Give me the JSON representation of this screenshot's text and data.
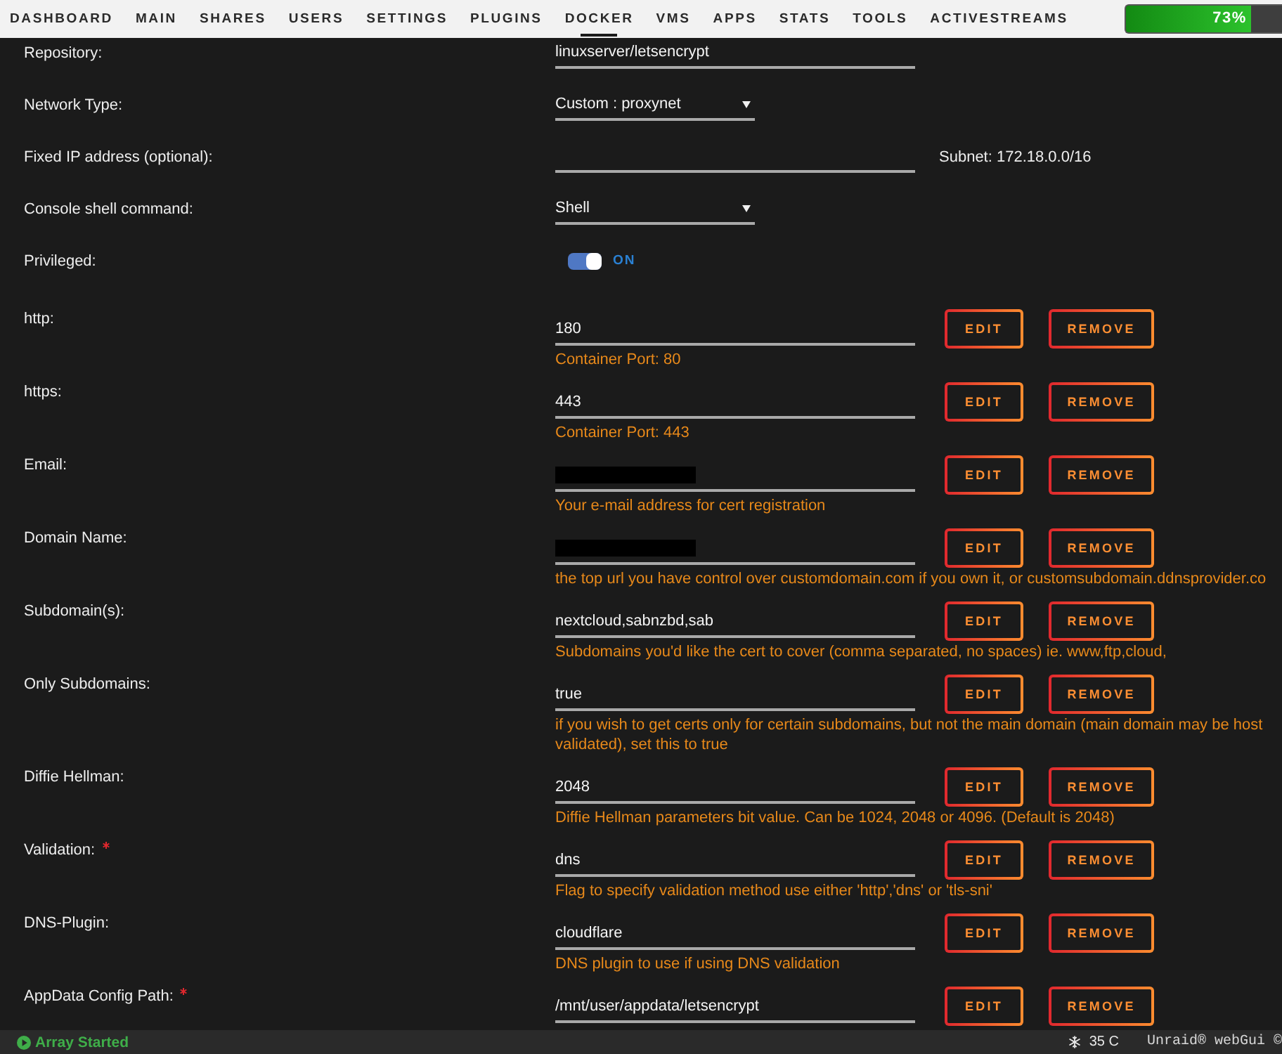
{
  "nav": {
    "items": [
      {
        "label": "DASHBOARD",
        "selected": false
      },
      {
        "label": "MAIN",
        "selected": false
      },
      {
        "label": "SHARES",
        "selected": false
      },
      {
        "label": "USERS",
        "selected": false
      },
      {
        "label": "SETTINGS",
        "selected": false
      },
      {
        "label": "PLUGINS",
        "selected": false
      },
      {
        "label": "DOCKER",
        "selected": true
      },
      {
        "label": "VMS",
        "selected": false
      },
      {
        "label": "APPS",
        "selected": false
      },
      {
        "label": "STATS",
        "selected": false
      },
      {
        "label": "TOOLS",
        "selected": false
      },
      {
        "label": "ACTIVESTREAMS",
        "selected": false
      }
    ],
    "cpu_meter": {
      "level": 0.8,
      "reading": "73%"
    }
  },
  "settings": [
    {
      "kind": "text",
      "label": "Repository:",
      "value": "linuxserver/letsencrypt"
    },
    {
      "kind": "select",
      "label": "Network Type:",
      "value": "Custom : proxynet"
    },
    {
      "kind": "text",
      "label": "Fixed IP address (optional):",
      "note": "Subnet: 172.18.0.0/16"
    },
    {
      "kind": "select",
      "label": "Console shell command:",
      "value": "Shell"
    },
    {
      "kind": "toggle",
      "label": "Privileged:",
      "on": true,
      "state_label": "ON"
    }
  ],
  "variables": [
    {
      "label": "http:",
      "required": false,
      "redacted": false,
      "value": "180",
      "buttons": [
        "EDIT",
        "REMOVE"
      ],
      "hint": "Container Port: 80"
    },
    {
      "label": "https:",
      "required": false,
      "redacted": false,
      "value": "443",
      "buttons": [
        "EDIT",
        "REMOVE"
      ],
      "hint": "Container Port: 443"
    },
    {
      "label": "Email:",
      "required": false,
      "redacted": true,
      "buttons": [
        "EDIT",
        "REMOVE"
      ],
      "hint": "Your e-mail address for cert registration"
    },
    {
      "label": "Domain Name:",
      "required": false,
      "redacted": true,
      "buttons": [
        "EDIT",
        "REMOVE"
      ],
      "hint": "the top url you have control over customdomain.com if you own it, or customsubdomain.ddnsprovider.co"
    },
    {
      "label": "Subdomain(s):",
      "required": false,
      "redacted": false,
      "value": "nextcloud,sabnzbd,sab",
      "buttons": [
        "EDIT",
        "REMOVE"
      ],
      "hint": "Subdomains you'd like the cert to cover (comma separated, no spaces) ie. www,ftp,cloud,"
    },
    {
      "label": "Only Subdomains:",
      "required": false,
      "redacted": false,
      "value": "true",
      "buttons": [
        "EDIT",
        "REMOVE"
      ],
      "hint": "if you wish to get certs only for certain subdomains, but not the main domain (main domain may be host\nvalidated), set this to true"
    },
    {
      "label": "Diffie Hellman:",
      "required": false,
      "redacted": false,
      "value": "2048",
      "buttons": [
        "EDIT",
        "REMOVE"
      ],
      "hint": "Diffie Hellman parameters bit value. Can be 1024, 2048 or 4096. (Default is 2048)"
    },
    {
      "label": "Validation:",
      "required": true,
      "redacted": false,
      "value": "dns",
      "buttons": [
        "EDIT",
        "REMOVE"
      ],
      "hint": "Flag to specify validation method use either 'http','dns' or 'tls-sni'"
    },
    {
      "label": "DNS-Plugin:",
      "required": false,
      "redacted": false,
      "value": "cloudflare",
      "buttons": [
        "EDIT",
        "REMOVE"
      ],
      "hint": "DNS plugin to use if using DNS validation"
    },
    {
      "label": "AppData Config Path:",
      "required": true,
      "redacted": false,
      "value": "/mnt/user/appdata/letsencrypt",
      "buttons": [
        "EDIT",
        "REMOVE"
      ]
    }
  ],
  "status_bar": {
    "array_status": "Array Started",
    "temperature": "35 C",
    "footer": "Unraid® webGui ©"
  }
}
